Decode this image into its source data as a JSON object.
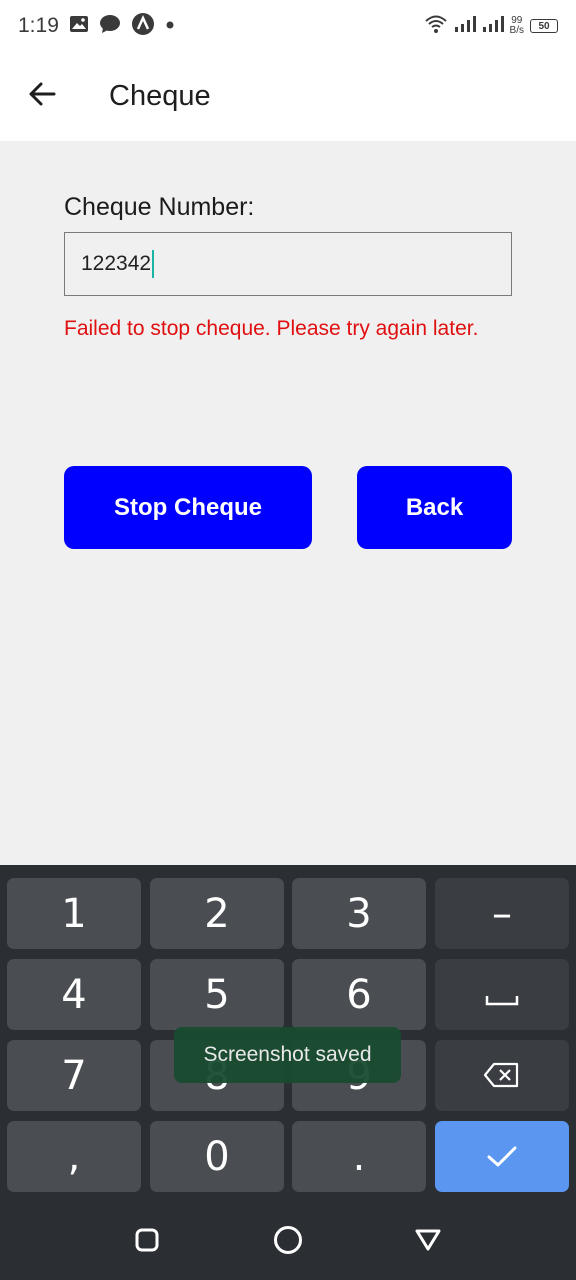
{
  "status_bar": {
    "time": "1:19",
    "net_speed_value": "99",
    "net_speed_unit": "B/s",
    "battery": "50",
    "icons": [
      "image-icon",
      "chat-bubble-icon",
      "app-notification-icon",
      "dot-icon",
      "wifi-icon",
      "signal-icon",
      "signal-icon-2"
    ]
  },
  "app_bar": {
    "title": "Cheque",
    "back_icon": "arrow-left-icon"
  },
  "form": {
    "label": "Cheque Number:",
    "input_value": "122342",
    "error_message": "Failed to stop cheque. Please try again later.",
    "stop_button": "Stop Cheque",
    "back_button": "Back"
  },
  "keyboard": {
    "keys": [
      "1",
      "2",
      "3",
      "–",
      "4",
      "5",
      "6",
      "␣",
      "7",
      "8",
      "9",
      "⌫",
      ",",
      "0",
      ".",
      "✓"
    ]
  },
  "toast": {
    "text": "Screenshot saved"
  },
  "nav_bar": {
    "icons": [
      "square-icon",
      "circle-icon",
      "triangle-icon"
    ]
  },
  "colors": {
    "button": "#0000ff",
    "error": "#e01010",
    "done_key": "#5b97f0",
    "cursor": "#1bb3a5"
  }
}
